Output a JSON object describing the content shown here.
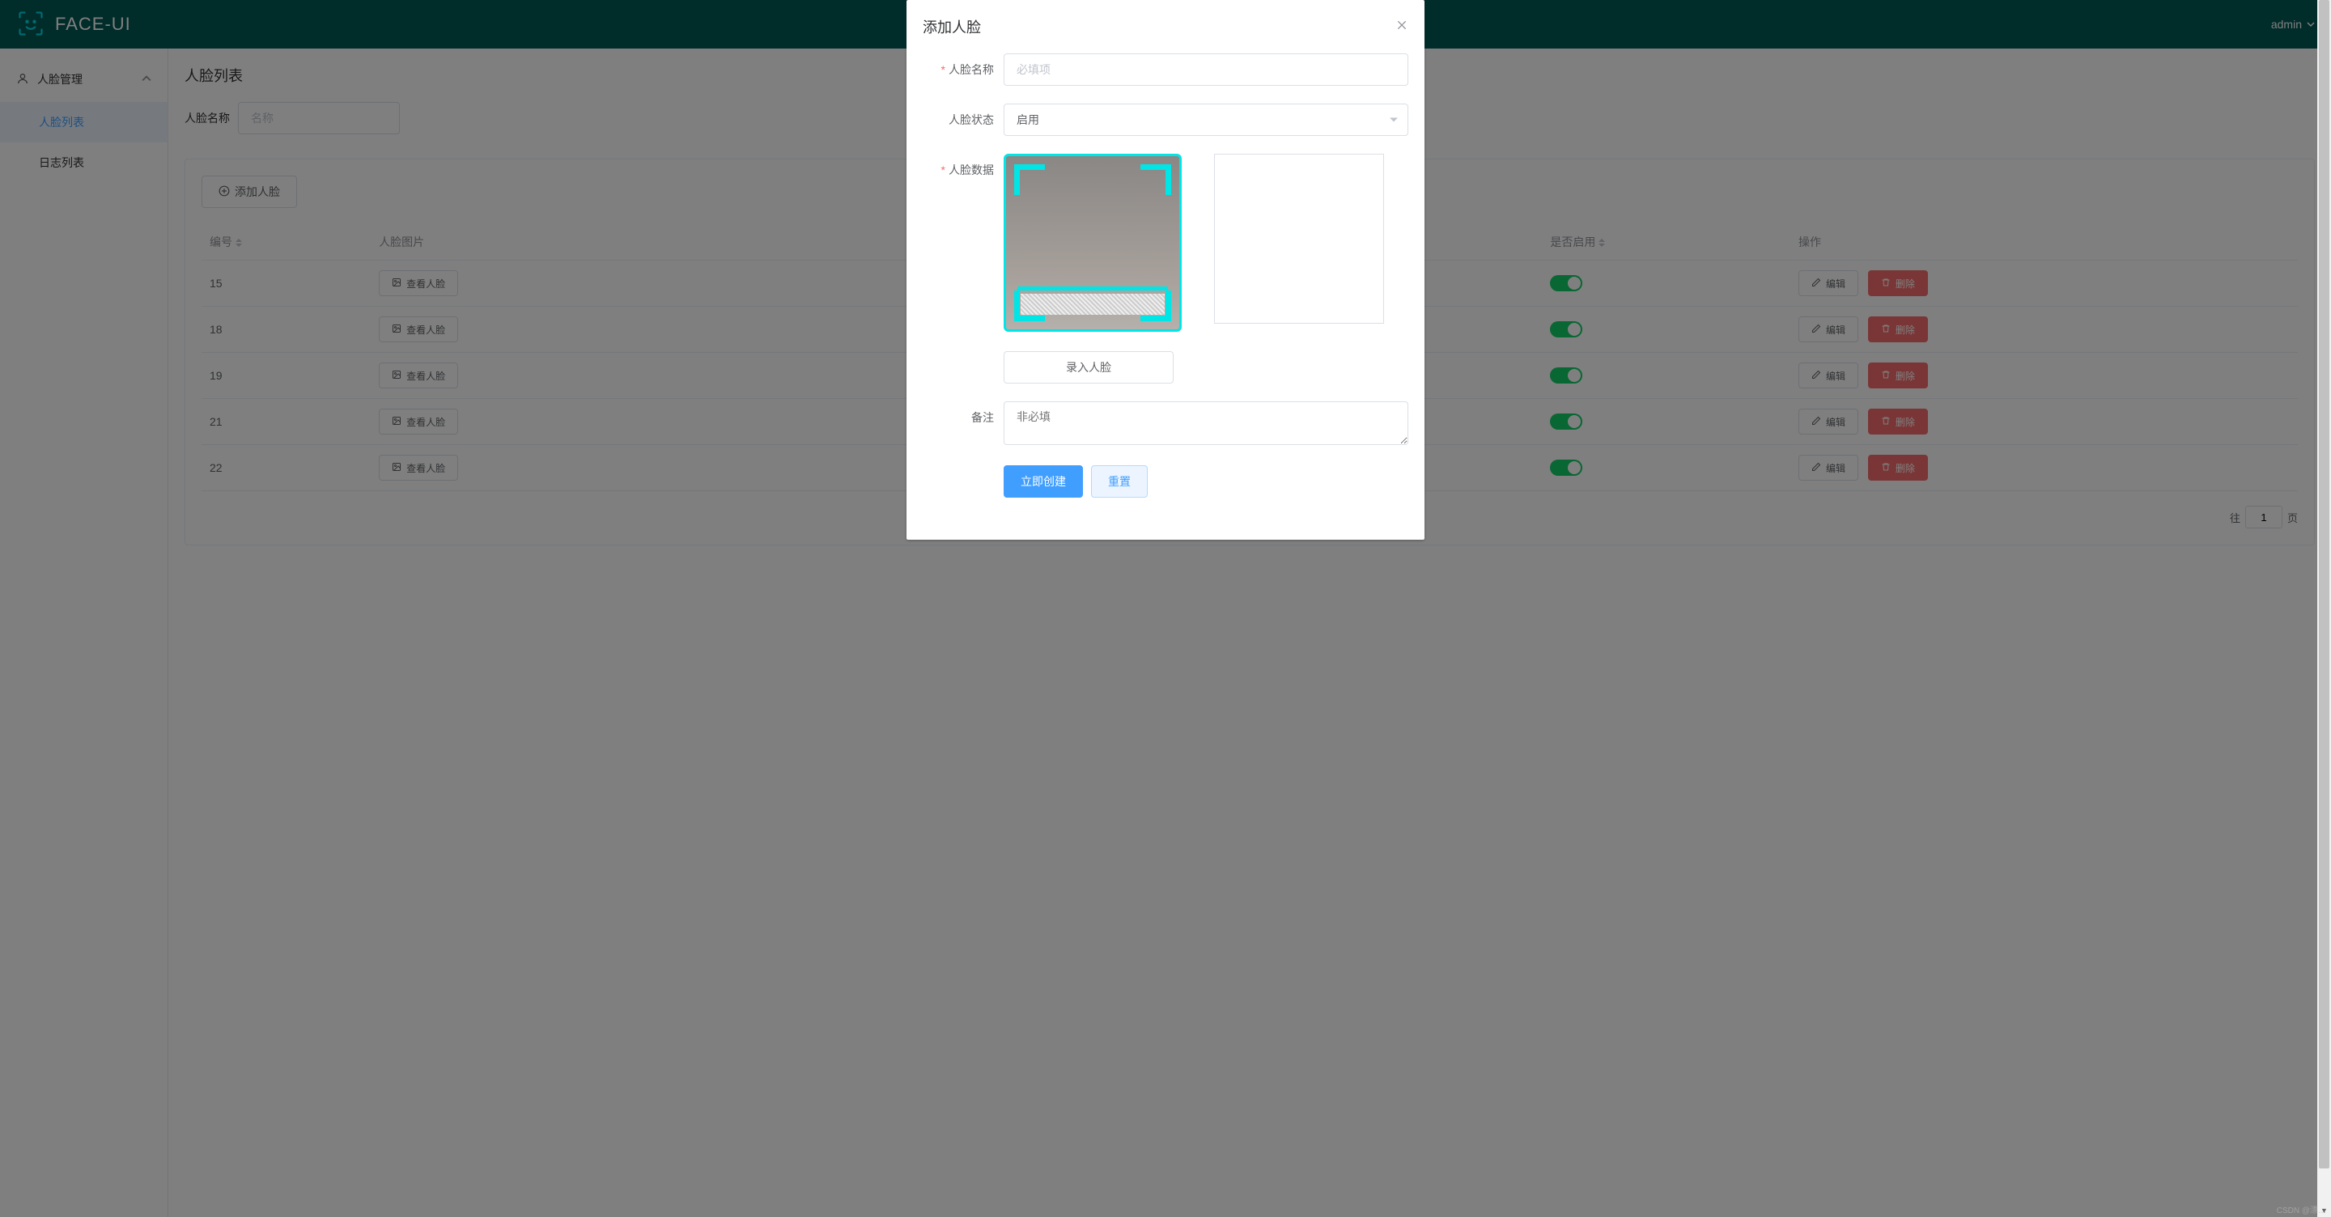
{
  "header": {
    "app_name": "FACE-UI",
    "user": "admin"
  },
  "sidebar": {
    "group_label": "人脸管理",
    "items": [
      {
        "label": "人脸列表",
        "active": true
      },
      {
        "label": "日志列表",
        "active": false
      }
    ]
  },
  "page": {
    "title": "人脸列表",
    "filter": {
      "name_label": "人脸名称",
      "name_placeholder": "名称"
    },
    "add_button": "添加人脸",
    "table": {
      "columns": {
        "id": "编号",
        "image": "人脸图片",
        "enabled": "是否启用",
        "ops": "操作"
      },
      "view_button_label": "查看人脸",
      "edit_button_label": "编辑",
      "delete_button_label": "删除",
      "rows": [
        {
          "id": "15",
          "enabled": true
        },
        {
          "id": "18",
          "enabled": true
        },
        {
          "id": "19",
          "enabled": true
        },
        {
          "id": "21",
          "enabled": true
        },
        {
          "id": "22",
          "enabled": true
        }
      ]
    },
    "pagination": {
      "goto_prefix": "往",
      "goto_suffix": "页",
      "current": "1"
    }
  },
  "dialog": {
    "title": "添加人脸",
    "fields": {
      "name": {
        "label": "人脸名称",
        "placeholder": "必填项",
        "required": true
      },
      "status": {
        "label": "人脸状态",
        "value": "启用",
        "required": false
      },
      "data": {
        "label": "人脸数据",
        "required": true
      },
      "remark": {
        "label": "备注",
        "placeholder": "非必填",
        "required": false
      }
    },
    "capture_button": "录入人脸",
    "submit_button": "立即创建",
    "reset_button": "重置"
  },
  "watermark": "CSDN @漂…"
}
